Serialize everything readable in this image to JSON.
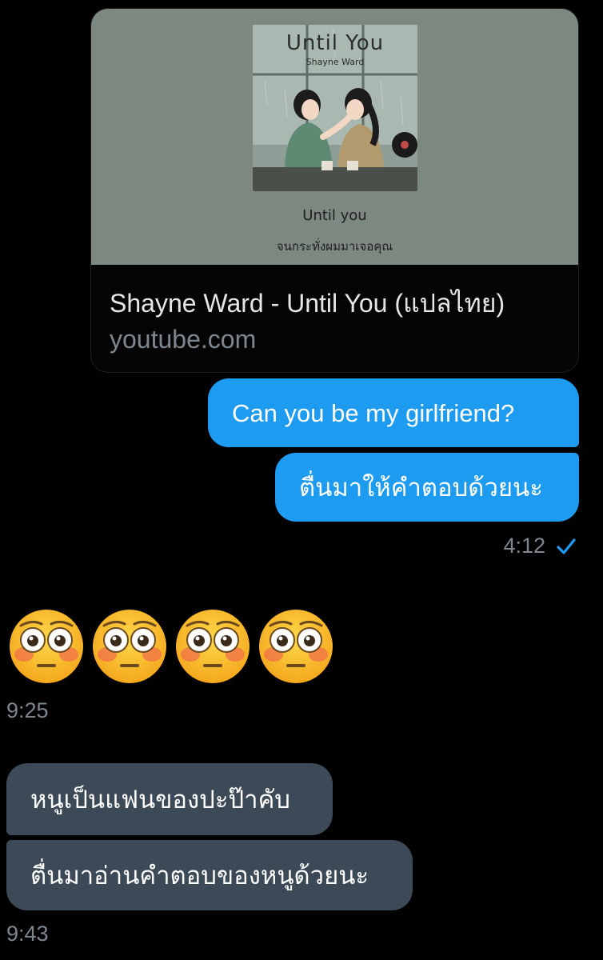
{
  "link_preview": {
    "artwork_title": "Until You",
    "artwork_artist": "Shayne Ward",
    "caption_line1": "Until you",
    "caption_line2": "จนกระทั่งผมมาเจอคุณ",
    "title": "Shayne Ward - Until You (แปลไทย)",
    "domain": "youtube.com"
  },
  "messages": {
    "outgoing": [
      "Can you be my girlfriend?",
      "ตื่นมาให้คำตอบด้วยนะ"
    ],
    "outgoing_time": "4:12",
    "emoji_time": "9:25",
    "incoming": [
      "หนูเป็นแฟนของปะป๊าคับ",
      "ตื่นมาอ่านคำตอบของหนูด้วยนะ"
    ],
    "incoming_time": "9:43"
  },
  "icons": {
    "read_check": "checkmark-icon",
    "emoji": "flushed-face-emoji"
  },
  "colors": {
    "outgoing_bubble": "#1d9bf0",
    "incoming_bubble": "#3c4956",
    "timestamp": "#7f878e",
    "background": "#000000"
  }
}
